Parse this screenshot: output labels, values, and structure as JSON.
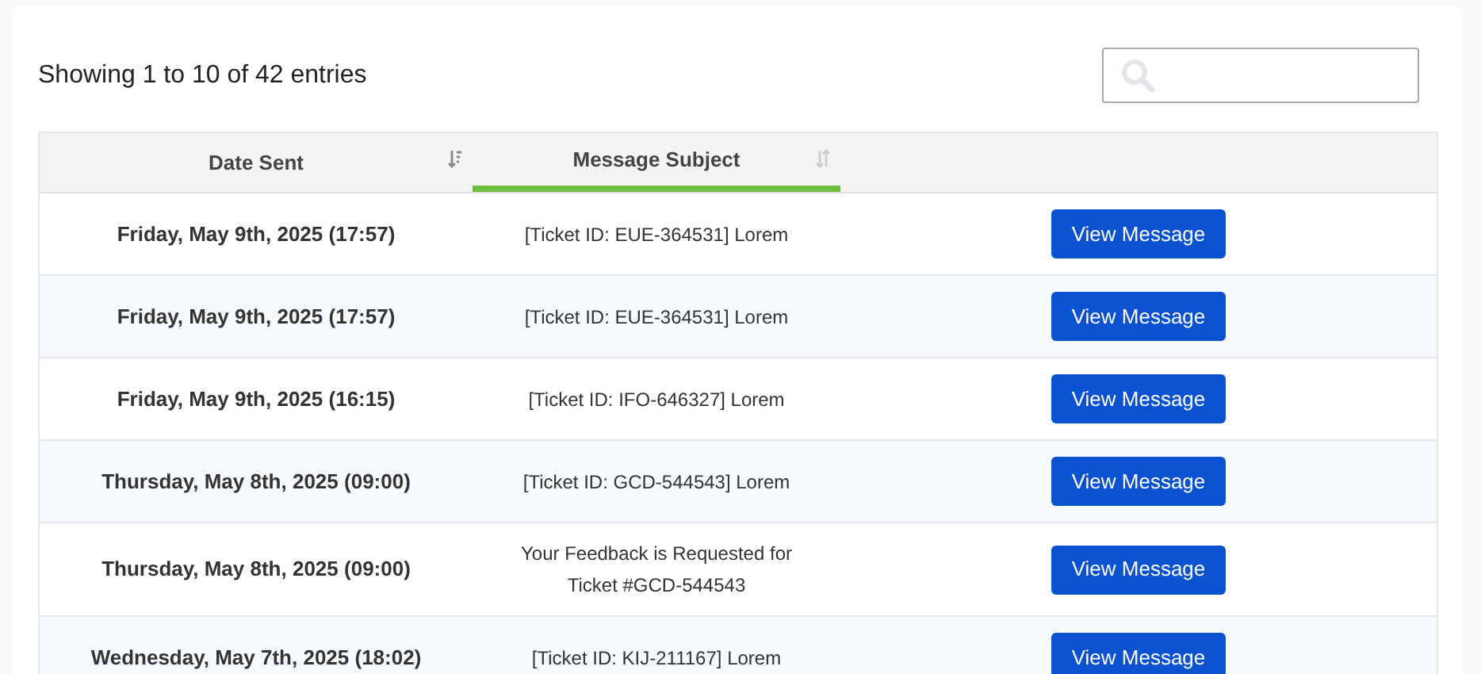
{
  "summary": "Showing 1 to 10 of 42 entries",
  "columns": [
    {
      "label": "Date Sent",
      "selected": false
    },
    {
      "label": "Message Subject",
      "selected": true
    }
  ],
  "rows": [
    {
      "date": "Friday, May 9th, 2025 (17:57)",
      "subject": "[Ticket ID: EUE-364531] Lorem",
      "action": "View Message"
    },
    {
      "date": "Friday, May 9th, 2025 (17:57)",
      "subject": "[Ticket ID: EUE-364531] Lorem",
      "action": "View Message"
    },
    {
      "date": "Friday, May 9th, 2025 (16:15)",
      "subject": "[Ticket ID: IFO-646327] Lorem",
      "action": "View Message"
    },
    {
      "date": "Thursday, May 8th, 2025 (09:00)",
      "subject": "[Ticket ID: GCD-544543] Lorem",
      "action": "View Message"
    },
    {
      "date": "Thursday, May 8th, 2025 (09:00)",
      "subject": "Your Feedback is Requested for Ticket #GCD-544543",
      "action": "View Message"
    },
    {
      "date": "Wednesday, May 7th, 2025 (18:02)",
      "subject": "[Ticket ID: KIJ-211167] Lorem",
      "action": "View Message"
    }
  ]
}
